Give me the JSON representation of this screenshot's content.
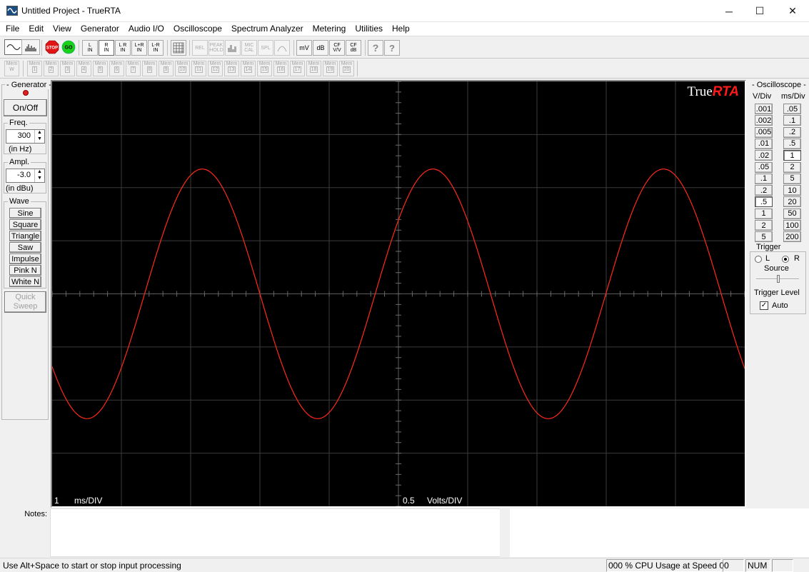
{
  "window": {
    "title": "Untitled Project - TrueRTA",
    "controls": {
      "minimize": "─",
      "maximize": "☐",
      "close": "✕"
    }
  },
  "menu": [
    "File",
    "Edit",
    "View",
    "Generator",
    "Audio I/O",
    "Oscilloscope",
    "Spectrum Analyzer",
    "Metering",
    "Utilities",
    "Help"
  ],
  "toolbar": {
    "stop": "STOP",
    "go": "GO",
    "inputs": [
      {
        "top": "L",
        "bottom": "IN"
      },
      {
        "top": "R",
        "bottom": "IN"
      },
      {
        "top": "L R",
        "bottom": "IN"
      },
      {
        "top": "L+R",
        "bottom": "IN"
      },
      {
        "top": "L-R",
        "bottom": "IN"
      }
    ],
    "rel": "REL",
    "peak_hold": {
      "top": "PEAK",
      "bottom": "HOLD"
    },
    "mic_cal": {
      "top": "MIC",
      "bottom": "CAL"
    },
    "spl": "SPL",
    "mv": "mV",
    "db": "dB",
    "cf_vv": {
      "top": "CF",
      "bottom": "V/V"
    },
    "cf_db": {
      "top": "CF",
      "bottom": "dB"
    },
    "help": "?",
    "context_help": "?"
  },
  "memory": {
    "label": "Mem",
    "write_sub": "W",
    "slots": [
      "1",
      "2",
      "3",
      "4",
      "5",
      "6",
      "7",
      "8",
      "9",
      "10",
      "11",
      "12",
      "13",
      "14",
      "15",
      "16",
      "17",
      "18",
      "19",
      "20"
    ]
  },
  "generator": {
    "title": "- Generator -",
    "on_off": "On/Off",
    "freq_label": "Freq.",
    "freq_value": "300",
    "freq_unit": "(in Hz)",
    "ampl_label": "Ampl.",
    "ampl_value": "-3.0",
    "ampl_unit": "(in dBu)",
    "wave_label": "Wave",
    "waves": [
      "Sine",
      "Square",
      "Triangle",
      "Saw",
      "Impulse",
      "Pink N",
      "White N"
    ],
    "quick_sweep": [
      "Quick",
      "Sweep"
    ],
    "led_color": "#e02020"
  },
  "scope": {
    "brand_true": "True",
    "brand_rta": "RTA",
    "time_div_value": "1",
    "time_div_unit": "ms/DIV",
    "volt_div_value": "0.5",
    "volt_div_unit": "Volts/DIV",
    "trace_color": "#ff2a1a",
    "grid_color": "#3b3b3b"
  },
  "scope_trace": {
    "amplitude_div": 2.35,
    "period_ms": 3.33,
    "crossing_ms": 6.33
  },
  "oscilloscope": {
    "title": "- Oscilloscope -",
    "vdiv_label": "V/Div",
    "msdiv_label": "ms/Div",
    "vdiv": [
      ".001",
      ".002",
      ".005",
      ".01",
      ".02",
      ".05",
      ".1",
      ".2",
      ".5",
      "1",
      "2",
      "5"
    ],
    "msdiv": [
      ".05",
      ".1",
      ".2",
      ".5",
      "1",
      "2",
      "5",
      "10",
      "20",
      "50",
      "100",
      "200"
    ],
    "selected_vdiv": ".5",
    "selected_msdiv": "1",
    "trigger_label": "Trigger",
    "source_l": "L",
    "source_r": "R",
    "source_selected": "R",
    "source_label": "Source",
    "trigger_level_label": "Trigger Level",
    "auto_label": "Auto",
    "auto_checked": true
  },
  "notes": {
    "label": "Notes:"
  },
  "status": {
    "message": "Use Alt+Space to start or stop input processing",
    "cpu": "000 % CPU Usage at Speed 00",
    "num": "NUM"
  }
}
